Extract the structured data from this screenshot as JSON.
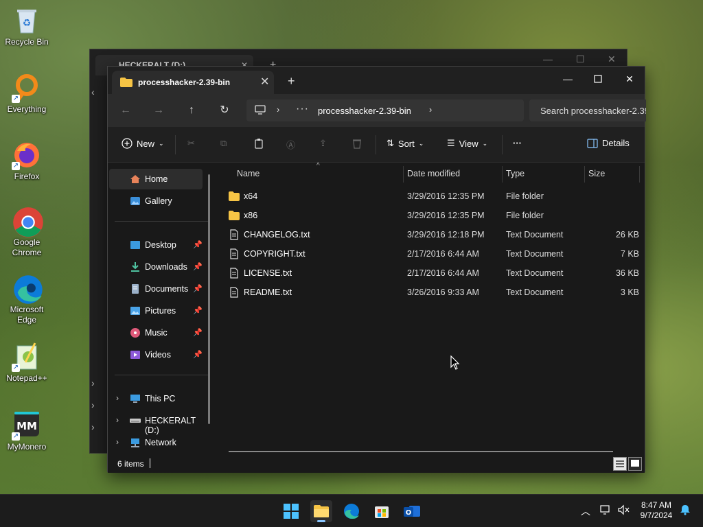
{
  "desktop": {
    "icons": [
      {
        "label": "Recycle Bin"
      },
      {
        "label": "Everything"
      },
      {
        "label": "Firefox"
      },
      {
        "label": "Google\nChrome"
      },
      {
        "label": "Microsoft\nEdge"
      },
      {
        "label": "Notepad++"
      },
      {
        "label": "MyMonero"
      }
    ]
  },
  "back_window": {
    "tab_title": "HECKERALT (D:)"
  },
  "window": {
    "tab_title": "processhacker-2.39-bin",
    "address": {
      "crumb": "processhacker-2.39-bin",
      "overflow": "···"
    },
    "search_placeholder": "Search processhacker-2.39-bin",
    "toolbar": {
      "new_label": "New",
      "sort_label": "Sort",
      "view_label": "View",
      "more_label": "···",
      "details_label": "Details"
    },
    "nav": {
      "home": "Home",
      "gallery": "Gallery",
      "quick": [
        {
          "label": "Desktop"
        },
        {
          "label": "Downloads"
        },
        {
          "label": "Documents"
        },
        {
          "label": "Pictures"
        },
        {
          "label": "Music"
        },
        {
          "label": "Videos"
        }
      ],
      "this_pc": "This PC",
      "drive": "HECKERALT (D:)",
      "network": "Network"
    },
    "columns": {
      "name": "Name",
      "date": "Date modified",
      "type": "Type",
      "size": "Size"
    },
    "files": [
      {
        "name": "x64",
        "date": "3/29/2016 12:35 PM",
        "type": "File folder",
        "size": "",
        "kind": "folder"
      },
      {
        "name": "x86",
        "date": "3/29/2016 12:35 PM",
        "type": "File folder",
        "size": "",
        "kind": "folder"
      },
      {
        "name": "CHANGELOG.txt",
        "date": "3/29/2016 12:18 PM",
        "type": "Text Document",
        "size": "26 KB",
        "kind": "doc"
      },
      {
        "name": "COPYRIGHT.txt",
        "date": "2/17/2016 6:44 AM",
        "type": "Text Document",
        "size": "7 KB",
        "kind": "doc"
      },
      {
        "name": "LICENSE.txt",
        "date": "2/17/2016 6:44 AM",
        "type": "Text Document",
        "size": "36 KB",
        "kind": "doc"
      },
      {
        "name": "README.txt",
        "date": "3/26/2016 9:33 AM",
        "type": "Text Document",
        "size": "3 KB",
        "kind": "doc"
      }
    ],
    "status": {
      "item_count": "6 items"
    }
  },
  "taskbar": {
    "time": "8:47 AM",
    "date": "9/7/2024"
  },
  "colors": {
    "folder": "#f6c445",
    "accent": "#8ac6ff"
  }
}
